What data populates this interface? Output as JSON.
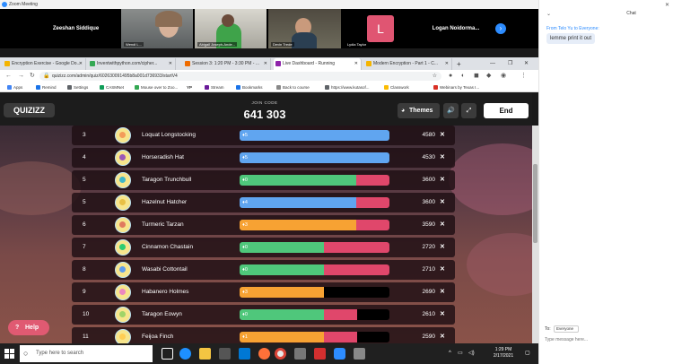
{
  "zoom": {
    "window_title": "Zoom Meeting",
    "participants": [
      {
        "name": "Zeeshan Siddique",
        "kind": "name"
      },
      {
        "caption": "Wendi L...",
        "kind": "video"
      },
      {
        "caption": "Abigail Joseph-Ande...",
        "kind": "video"
      },
      {
        "caption": "Devin Trede",
        "kind": "video"
      },
      {
        "avatar_letter": "L",
        "caption": "Lydia Taylor",
        "kind": "avatar"
      },
      {
        "name": "Logan Noidorma...",
        "kind": "name"
      }
    ]
  },
  "browser": {
    "tabs": [
      {
        "label": "Encryption Exercise - Google Do...",
        "color": "#f4b400"
      },
      {
        "label": "Inventwithpython.com/cipher...",
        "color": "#34a853"
      },
      {
        "label": "Session 3: 1:20 PM - 3:30 PM - ...",
        "color": "#ef6c00"
      },
      {
        "label": "Live Dashboard - Running",
        "color": "#8e24aa"
      },
      {
        "label": "Modern Encryption - Part 1 - C...",
        "color": "#f4b400"
      }
    ],
    "new_tab": "+",
    "url": "quizizz.com/admin/quiz/602630091495b8a001d736933/startV4",
    "bookmarks": [
      {
        "label": "Apps",
        "color": "#4285f4"
      },
      {
        "label": "Remind",
        "color": "#1a73e8"
      },
      {
        "label": "Settings",
        "color": "#5f6368"
      },
      {
        "label": "CASMNet",
        "color": "#0f9d58"
      },
      {
        "label": "Mouse over to Zoo...",
        "color": "#34a853"
      },
      {
        "label": "YP",
        "color": "#000000"
      },
      {
        "label": "Stream",
        "color": "#6a1b9a"
      },
      {
        "label": "Bookmarks",
        "color": "#1a73e8"
      },
      {
        "label": "Back to course",
        "color": "#888888"
      },
      {
        "label": "https://www.kutasof...",
        "color": "#5f6368"
      },
      {
        "label": "Classwork",
        "color": "#fbbc04"
      },
      {
        "label": "Webinars by Texas I...",
        "color": "#d93025"
      }
    ]
  },
  "quizizz": {
    "logo": "QUIZIZZ",
    "join_label": "JOIN CODE",
    "join_code": "641 303",
    "themes_label": "Themes",
    "end_label": "End",
    "help_label": "Help",
    "leaderboard": [
      {
        "rank": "3",
        "name": "Loquat Longstocking",
        "streak": "5",
        "score": "4580",
        "correct": 1.0,
        "incorrect": 0,
        "bar": "blue"
      },
      {
        "rank": "4",
        "name": "Horseradish Hat",
        "streak": "5",
        "score": "4530",
        "correct": 1.0,
        "incorrect": 0,
        "bar": "blue"
      },
      {
        "rank": "5",
        "name": "Taragon Trunchbull",
        "streak": "0",
        "score": "3600",
        "correct": 0.78,
        "incorrect": 0.22,
        "bar": "green"
      },
      {
        "rank": "5",
        "name": "Hazelnut Hatcher",
        "streak": "4",
        "score": "3600",
        "correct": 0.78,
        "incorrect": 0.22,
        "bar": "blue"
      },
      {
        "rank": "6",
        "name": "Turmeric Tarzan",
        "streak": "3",
        "score": "3590",
        "correct": 0.78,
        "incorrect": 0.22,
        "bar": "orange"
      },
      {
        "rank": "7",
        "name": "Cinnamon Chastain",
        "streak": "0",
        "score": "2720",
        "correct": 0.56,
        "incorrect": 0.44,
        "bar": "green"
      },
      {
        "rank": "8",
        "name": "Wasabi Cottontail",
        "streak": "0",
        "score": "2710",
        "correct": 0.56,
        "incorrect": 0.44,
        "bar": "green"
      },
      {
        "rank": "9",
        "name": "Habanero Holmes",
        "streak": "3",
        "score": "2690",
        "correct": 0.56,
        "incorrect": 0,
        "bar": "orange"
      },
      {
        "rank": "10",
        "name": "Taragon Eowyn",
        "streak": "0",
        "score": "2610",
        "correct": 0.56,
        "incorrect": 0.22,
        "bar": "green"
      },
      {
        "rank": "11",
        "name": "Feijoa Finch",
        "streak": "1",
        "score": "2590",
        "correct": 0.56,
        "incorrect": 0.22,
        "bar": "orange"
      }
    ],
    "colors": {
      "blue": "#60a5f0",
      "green": "#4fc77b",
      "orange": "#f7a233",
      "red": "#e0476b"
    }
  },
  "taskbar": {
    "search_placeholder": "Type here to search",
    "time": "1:29 PM",
    "date": "2/17/2021"
  },
  "chat": {
    "title": "Chat",
    "from": "From Telo Yu to Everyone:",
    "message": "lemme print it out",
    "to_label": "To:",
    "recipient": "Everyone",
    "input_placeholder": "Type message here..."
  }
}
